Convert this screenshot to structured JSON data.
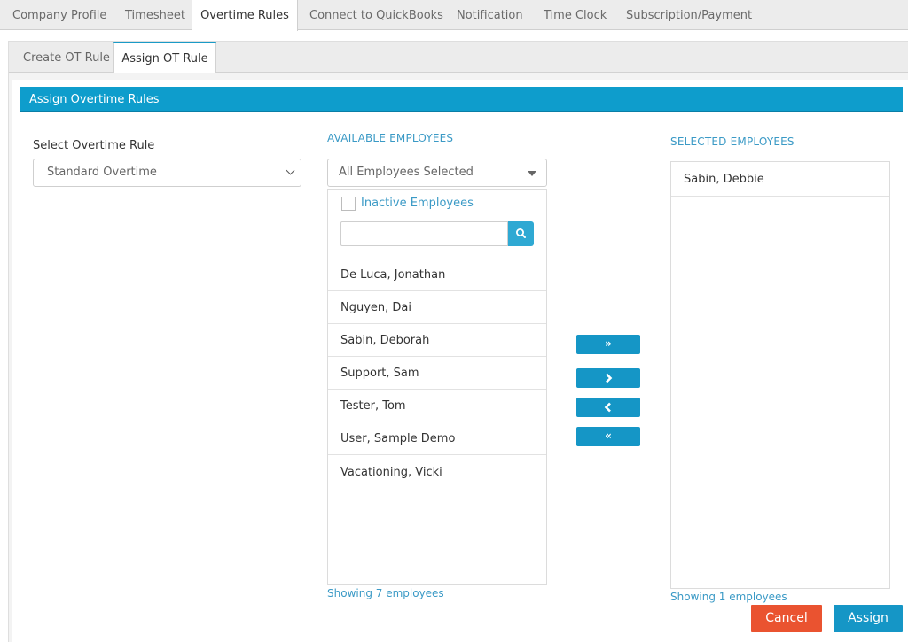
{
  "top_tabs": [
    {
      "label": "Company Profile"
    },
    {
      "label": "Timesheet"
    },
    {
      "label": "Overtime Rules"
    },
    {
      "label": "Connect to QuickBooks"
    },
    {
      "label": "Notification"
    },
    {
      "label": "Time Clock"
    },
    {
      "label": "Subscription/Payment"
    }
  ],
  "active_top_tab": "Overtime Rules",
  "sub_tabs": [
    {
      "label": "Create OT Rule"
    },
    {
      "label": "Assign OT Rule"
    }
  ],
  "active_sub_tab": "Assign OT Rule",
  "panel": {
    "title": "Assign Overtime Rules"
  },
  "rule_select": {
    "label": "Select Overtime Rule",
    "value": "Standard Overtime"
  },
  "available": {
    "title": "AVAILABLE EMPLOYEES",
    "filter_value": "All Employees Selected",
    "inactive_label": "Inactive Employees",
    "search_value": "",
    "employees": [
      "De Luca, Jonathan",
      "Nguyen, Dai",
      "Sabin, Deborah",
      "Support, Sam",
      "Tester, Tom",
      "User, Sample Demo",
      "Vacationing, Vicki"
    ],
    "footer": "Showing 7 employees"
  },
  "move_buttons": {
    "move_all_right": "»",
    "move_right": "›",
    "move_left": "‹",
    "move_all_left": "«"
  },
  "selected": {
    "title": "SELECTED EMPLOYEES",
    "employees": [
      "Sabin, Debbie"
    ],
    "footer": "Showing 1 employees"
  },
  "actions": {
    "cancel_label": "Cancel",
    "assign_label": "Assign"
  },
  "colors": {
    "primary": "#0e9dcc",
    "cancel": "#ea5330",
    "assign": "#1596c6",
    "link": "#3b9ac6"
  }
}
